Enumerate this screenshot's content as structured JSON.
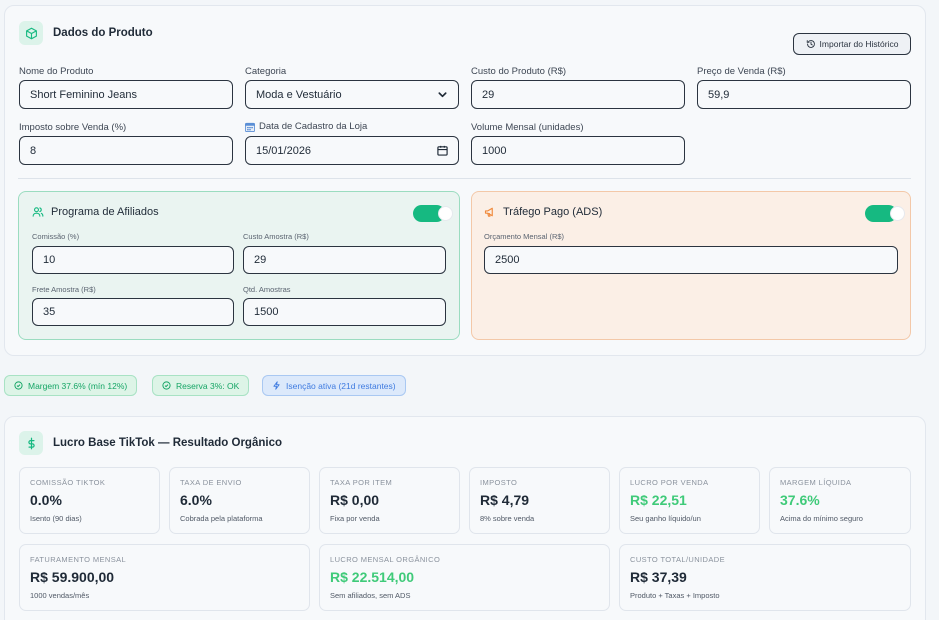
{
  "product_card": {
    "title": "Dados do Produto",
    "icon": "box-icon",
    "import_button": "Importar do Histórico",
    "fields": {
      "name": {
        "label": "Nome do Produto",
        "value": "Short Feminino Jeans"
      },
      "category": {
        "label": "Categoria",
        "value": "Moda e Vestuário"
      },
      "cost": {
        "label": "Custo do Produto (R$)",
        "value": "29"
      },
      "price": {
        "label": "Preço de Venda (R$)",
        "value": "59,9"
      },
      "tax": {
        "label": "Imposto sobre Venda (%)",
        "value": "8"
      },
      "register_date": {
        "label": "Data de Cadastro da Loja",
        "value": "15/01/2026"
      },
      "volume": {
        "label": "Volume Mensal (unidades)",
        "value": "1000"
      }
    },
    "affiliates": {
      "title": "Programa de Afiliados",
      "enabled": true,
      "commission": {
        "label": "Comissão (%)",
        "value": "10"
      },
      "sample_cost": {
        "label": "Custo Amostra (R$)",
        "value": "29"
      },
      "sample_shipping": {
        "label": "Frete Amostra (R$)",
        "value": "35"
      },
      "sample_qty": {
        "label": "Qtd. Amostras",
        "value": "1500"
      }
    },
    "ads": {
      "title": "Tráfego Pago (ADS)",
      "enabled": true,
      "budget": {
        "label": "Orçamento Mensal (R$)",
        "value": "2500"
      }
    }
  },
  "badges": [
    {
      "text": "Margem 37.6% (mín 12%)",
      "tone": "green"
    },
    {
      "text": "Reserva 3%: OK",
      "tone": "green"
    },
    {
      "text": "Isenção ativa (21d restantes)",
      "tone": "blue"
    }
  ],
  "results_card": {
    "title": "Lucro Base TikTok — Resultado Orgânico",
    "icon": "dollar-icon",
    "metrics": [
      {
        "label": "Comissão TikTok",
        "value": "0.0%",
        "sub": "Isento (90 dias)"
      },
      {
        "label": "Taxa de Envio",
        "value": "6.0%",
        "sub": "Cobrada pela plataforma"
      },
      {
        "label": "Taxa por Item",
        "value": "R$ 0,00",
        "sub": "Fixa por venda"
      },
      {
        "label": "Imposto",
        "value": "R$ 4,79",
        "sub": "8% sobre venda"
      },
      {
        "label": "Lucro por Venda",
        "value": "R$ 22,51",
        "sub": "Seu ganho líquido/un"
      },
      {
        "label": "Margem Líquida",
        "value": "37.6%",
        "sub": "Acima do mínimo seguro"
      },
      {
        "label": "Faturamento Mensal",
        "value": "R$ 59.900,00",
        "sub": "1000 vendas/mês"
      },
      {
        "label": "Lucro Mensal Orgânico",
        "value": "R$ 22.514,00",
        "sub": "Sem afiliados, sem ADS"
      },
      {
        "label": "Custo Total/Unidade",
        "value": "R$ 37,39",
        "sub": "Produto + Taxas + Imposto"
      }
    ]
  },
  "colors": {
    "accent": "#16b981",
    "green_text": "#3fca79",
    "blue_badge": "#3f7be0"
  }
}
